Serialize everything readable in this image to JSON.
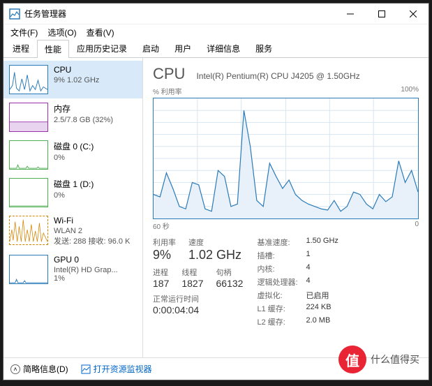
{
  "titlebar": {
    "title": "任务管理器"
  },
  "menu": {
    "file": "文件(F)",
    "options": "选项(O)",
    "view": "查看(V)"
  },
  "tabs": [
    "进程",
    "性能",
    "应用历史记录",
    "启动",
    "用户",
    "详细信息",
    "服务"
  ],
  "sidebar": [
    {
      "name": "CPU",
      "line1": "9% 1.02 GHz",
      "line2": "",
      "color": "#2a7ab8"
    },
    {
      "name": "内存",
      "line1": "2.5/7.8 GB (32%)",
      "line2": "",
      "color": "#9b2fae"
    },
    {
      "name": "磁盘 0 (C:)",
      "line1": "0%",
      "line2": "",
      "color": "#4caf50"
    },
    {
      "name": "磁盘 1 (D:)",
      "line1": "0%",
      "line2": "",
      "color": "#4caf50"
    },
    {
      "name": "Wi-Fi",
      "line1": "WLAN 2",
      "line2": "发送: 288 接收: 96.0 K",
      "color": "#d68400"
    },
    {
      "name": "GPU 0",
      "line1": "Intel(R) HD Grap...",
      "line2": "1%",
      "color": "#2a7ab8"
    }
  ],
  "main": {
    "title": "CPU",
    "subtitle": "Intel(R) Pentium(R) CPU J4205 @ 1.50GHz",
    "util_label": "% 利用率",
    "util_max": "100%",
    "xaxis_left": "60 秒",
    "xaxis_right": "0"
  },
  "chart_data": {
    "type": "line",
    "title": "CPU % 利用率",
    "xlabel": "60 秒",
    "ylabel": "% 利用率",
    "ylim": [
      0,
      100
    ],
    "xlim": [
      60,
      0
    ],
    "values": [
      20,
      18,
      38,
      25,
      10,
      8,
      30,
      28,
      8,
      6,
      40,
      35,
      10,
      12,
      90,
      60,
      15,
      10,
      46,
      35,
      25,
      32,
      20,
      15,
      12,
      10,
      8,
      7,
      15,
      6,
      10,
      22,
      20,
      12,
      8,
      20,
      14,
      18,
      48,
      30,
      40,
      22
    ]
  },
  "stats": {
    "util_lbl": "利用率",
    "util_val": "9%",
    "speed_lbl": "速度",
    "speed_val": "1.02 GHz",
    "proc_lbl": "进程",
    "proc_val": "187",
    "thread_lbl": "线程",
    "thread_val": "1827",
    "handle_lbl": "句柄",
    "handle_val": "66132",
    "uptime_lbl": "正常运行时间",
    "uptime_val": "0:00:04:04",
    "base_lbl": "基准速度:",
    "base_val": "1.50 GHz",
    "sockets_lbl": "插槽:",
    "sockets_val": "1",
    "cores_lbl": "内核:",
    "cores_val": "4",
    "lproc_lbl": "逻辑处理器:",
    "lproc_val": "4",
    "virt_lbl": "虚拟化:",
    "virt_val": "已启用",
    "l1_lbl": "L1 缓存:",
    "l1_val": "224 KB",
    "l2_lbl": "L2 缓存:",
    "l2_val": "2.0 MB"
  },
  "footer": {
    "fewer": "简略信息(D)",
    "resmon": "打开资源监视器"
  },
  "watermark": "什么值得买"
}
